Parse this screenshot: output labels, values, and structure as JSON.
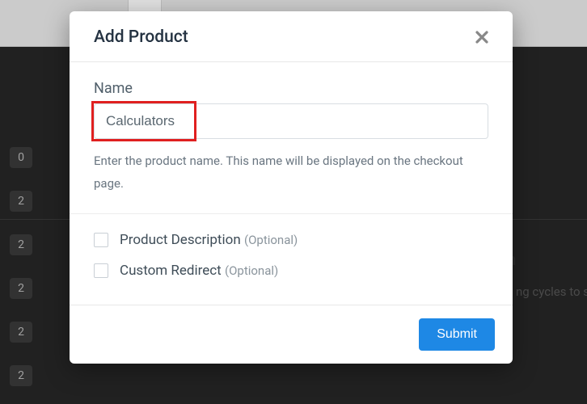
{
  "modal": {
    "title": "Add Product",
    "name_label": "Name",
    "name_value": "Calculators",
    "name_help": "Enter the product name. This name will be displayed on the checkout page.",
    "checkboxes": [
      {
        "label": "Product Description",
        "optional": "(Optional)"
      },
      {
        "label": "Custom Redirect",
        "optional": "(Optional)"
      }
    ],
    "submit_label": "Submit"
  },
  "background": {
    "badges": [
      "0",
      "2",
      "2",
      "2",
      "2",
      "2"
    ],
    "right_heading_fragment": "n",
    "right_text_fragment": "ng cycles to s"
  }
}
